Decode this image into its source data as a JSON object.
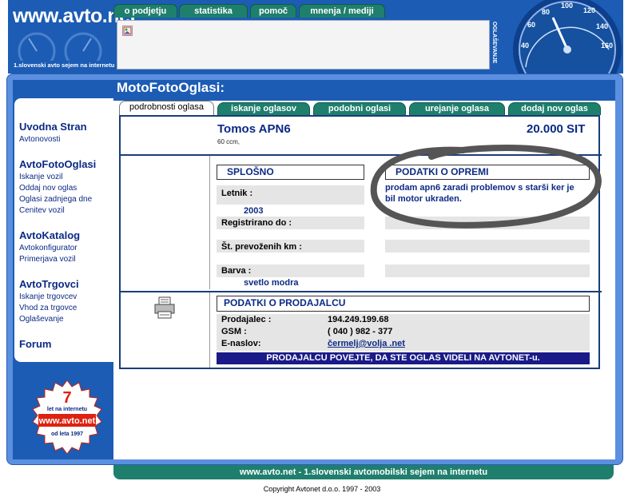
{
  "header": {
    "logo": "www.avto.net",
    "tagline": "1.slovenski avto sejem na internetu",
    "nav": [
      "o podjetju",
      "statistika",
      "pomoč",
      "mnenja / mediji"
    ],
    "side_label": "OGLAŠEVANJE",
    "gauge_ticks": [
      "40",
      "60",
      "80",
      "100",
      "120",
      "140",
      "160"
    ]
  },
  "page_title": "MotoFotoOglasi:",
  "sidebar": {
    "sections": [
      {
        "title": "Uvodna Stran",
        "links": [
          "Avtonovosti"
        ]
      },
      {
        "title": "AvtoFotoOglasi",
        "links": [
          "Iskanje vozil",
          "Oddaj nov oglas",
          "Oglasi zadnjega dne",
          "Cenitev vozil"
        ]
      },
      {
        "title": "AvtoKatalog",
        "links": [
          "Avtokonfigurator",
          "Primerjava vozil"
        ]
      },
      {
        "title": "AvtoTrgovci",
        "links": [
          "Iskanje trgovcev",
          "Vhod za trgovce",
          "Oglaševanje"
        ]
      },
      {
        "title": "Forum",
        "links": []
      }
    ],
    "badge": {
      "years": "7",
      "line1": "let na internetu",
      "logo": "www.avto.net",
      "line2": "od leta 1997"
    }
  },
  "tabs": [
    "podrobnosti oglasa",
    "iskanje oglasov",
    "podobni oglasi",
    "urejanje oglasa",
    "dodaj nov oglas"
  ],
  "listing": {
    "title": "Tomos  APN6",
    "price": "20.000 SIT",
    "engine": "60 ccm,",
    "general_header": "SPLOŠNO",
    "equipment_header": "PODATKI O OPREMI",
    "description": "prodam apn6 zaradi problemov s starši ker je bil motor ukraden.",
    "fields": [
      {
        "label": "Letnik :",
        "value": "2003"
      },
      {
        "label": "Registrirano do :",
        "value": ""
      },
      {
        "label": "Št. prevoženih km :",
        "value": ""
      },
      {
        "label": "Barva :",
        "value": "svetlo modra"
      }
    ]
  },
  "seller": {
    "header": "PODATKI O PRODAJALCU",
    "seller_label": "Prodajalec :",
    "seller_value": "194.249.199.68",
    "gsm_label": "GSM :",
    "gsm_value": "( 040 ) 982 - 377",
    "email_label": "E-naslov:",
    "email_value": "čermelj@volja .net",
    "banner": "PRODAJALCU POVEJTE, DA STE OGLAS VIDELI NA AVTONET-u."
  },
  "footer": {
    "bar": "www.avto.net - 1.slovenski avtomobilski sejem na internetu",
    "copyright": "Copyright Avtonet d.o.o. 1997 - 2003"
  },
  "colors": {
    "primary_blue": "#1c5cb4",
    "frame_blue": "#5b8fe0",
    "tab_green": "#1f7f6d",
    "text_navy": "#0b2a84"
  }
}
